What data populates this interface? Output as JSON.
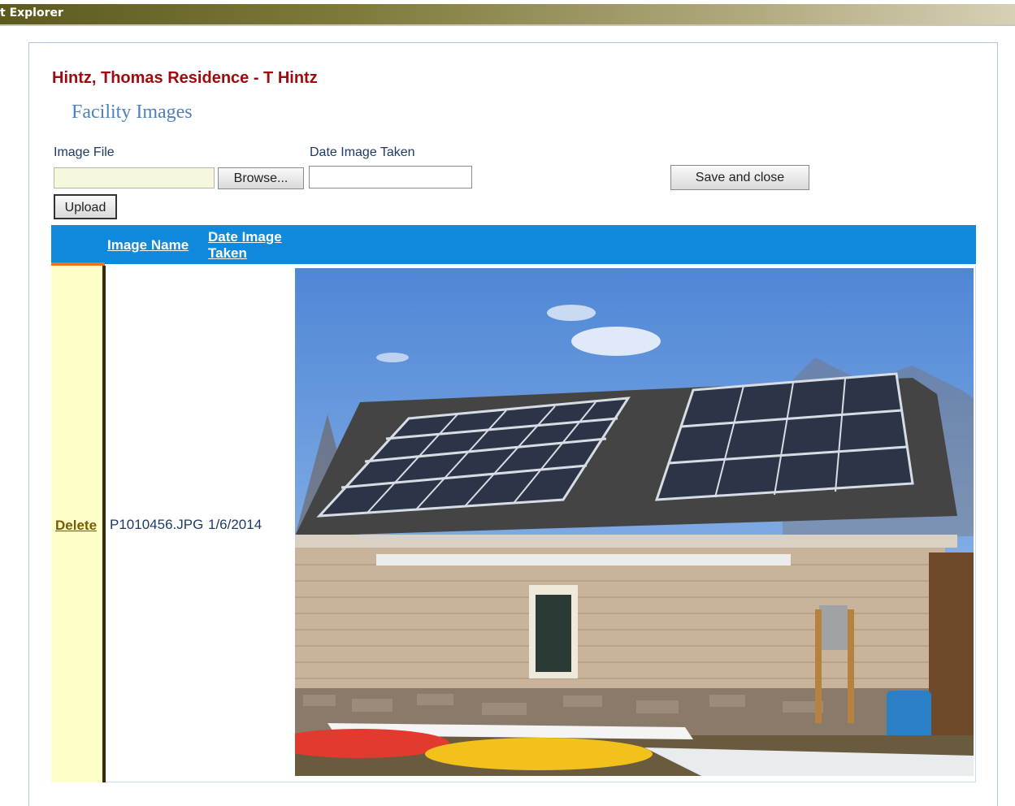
{
  "window": {
    "title": "t Explorer"
  },
  "page": {
    "title": "Hintz, Thomas Residence - T Hintz",
    "section_title": "Facility Images"
  },
  "form": {
    "image_file_label": "Image File",
    "date_label": "Date Image Taken",
    "browse_label": "Browse...",
    "save_label": "Save and close",
    "upload_label": "Upload",
    "image_file_value": "",
    "date_value": ""
  },
  "grid": {
    "columns": [
      "Image Name",
      "Date Image\nTaken"
    ],
    "col_image_name": "Image Name",
    "col_date_line1": "Date Image",
    "col_date_line2": "Taken",
    "rows": [
      {
        "action": "Delete",
        "image_name": "P1010456.JPG",
        "date_taken": "1/6/2014"
      }
    ]
  },
  "colors": {
    "header_bg": "#0e89dc",
    "title_red": "#9e0b0f",
    "section_blue": "#4f81bd",
    "delete_cell_bg": "#fefec8"
  }
}
